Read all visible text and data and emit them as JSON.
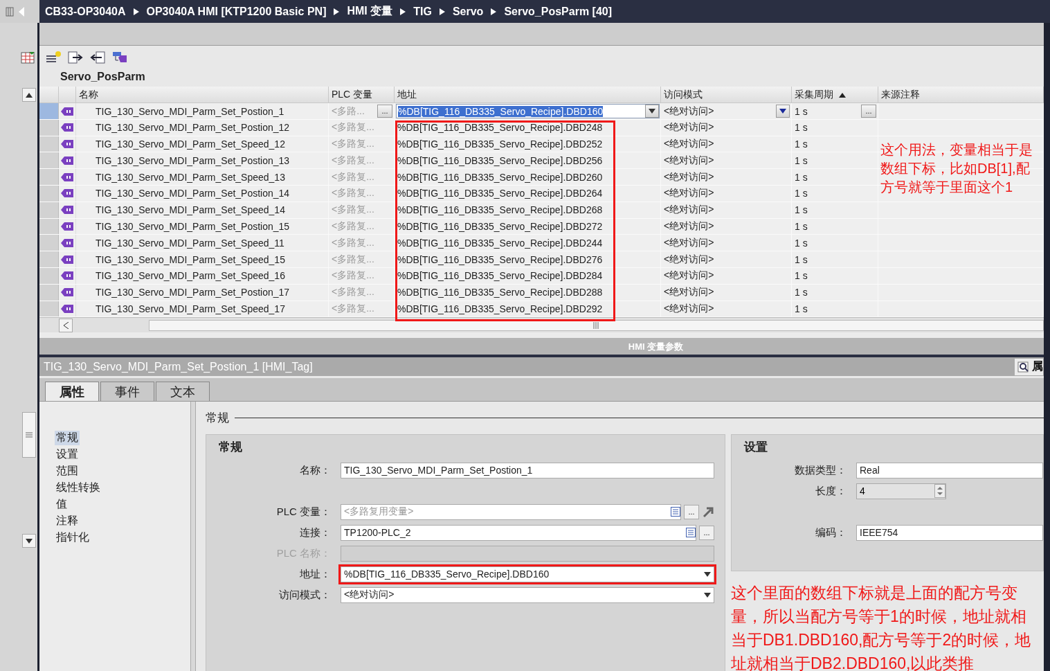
{
  "breadcrumb": [
    "CB33-OP3040A",
    "OP3040A HMI [KTP1200 Basic PN]",
    "HMI 变量",
    "TIG",
    "Servo",
    "Servo_PosParm [40]"
  ],
  "editor_title": "Servo_PosParm",
  "table": {
    "columns": [
      {
        "label": "名称",
        "sorted": false
      },
      {
        "label": "PLC 变量",
        "sorted": false
      },
      {
        "label": "地址",
        "sorted": false
      },
      {
        "label": "访问模式",
        "sorted": false
      },
      {
        "label": "采集周期",
        "sorted": true
      },
      {
        "label": "来源注释",
        "sorted": false
      }
    ],
    "browse_label": "...",
    "rows": [
      {
        "name": "TIG_130_Servo_MDI_Parm_Set_Postion_1",
        "plc_tag": "<多路...",
        "address": "%DB[TIG_116_DB335_Servo_Recipe].DBD160",
        "access": "<绝对访问>",
        "cycle": "1 s",
        "selected": true
      },
      {
        "name": "TIG_130_Servo_MDI_Parm_Set_Postion_12",
        "plc_tag": "<多路复...",
        "address": "%DB[TIG_116_DB335_Servo_Recipe].DBD248",
        "access": "<绝对访问>",
        "cycle": "1 s",
        "selected": false
      },
      {
        "name": "TIG_130_Servo_MDI_Parm_Set_Speed_12",
        "plc_tag": "<多路复...",
        "address": "%DB[TIG_116_DB335_Servo_Recipe].DBD252",
        "access": "<绝对访问>",
        "cycle": "1 s",
        "selected": false
      },
      {
        "name": "TIG_130_Servo_MDI_Parm_Set_Postion_13",
        "plc_tag": "<多路复...",
        "address": "%DB[TIG_116_DB335_Servo_Recipe].DBD256",
        "access": "<绝对访问>",
        "cycle": "1 s",
        "selected": false
      },
      {
        "name": "TIG_130_Servo_MDI_Parm_Set_Speed_13",
        "plc_tag": "<多路复...",
        "address": "%DB[TIG_116_DB335_Servo_Recipe].DBD260",
        "access": "<绝对访问>",
        "cycle": "1 s",
        "selected": false
      },
      {
        "name": "TIG_130_Servo_MDI_Parm_Set_Postion_14",
        "plc_tag": "<多路复...",
        "address": "%DB[TIG_116_DB335_Servo_Recipe].DBD264",
        "access": "<绝对访问>",
        "cycle": "1 s",
        "selected": false
      },
      {
        "name": "TIG_130_Servo_MDI_Parm_Set_Speed_14",
        "plc_tag": "<多路复...",
        "address": "%DB[TIG_116_DB335_Servo_Recipe].DBD268",
        "access": "<绝对访问>",
        "cycle": "1 s",
        "selected": false
      },
      {
        "name": "TIG_130_Servo_MDI_Parm_Set_Postion_15",
        "plc_tag": "<多路复...",
        "address": "%DB[TIG_116_DB335_Servo_Recipe].DBD272",
        "access": "<绝对访问>",
        "cycle": "1 s",
        "selected": false
      },
      {
        "name": "TIG_130_Servo_MDI_Parm_Set_Speed_11",
        "plc_tag": "<多路复...",
        "address": "%DB[TIG_116_DB335_Servo_Recipe].DBD244",
        "access": "<绝对访问>",
        "cycle": "1 s",
        "selected": false
      },
      {
        "name": "TIG_130_Servo_MDI_Parm_Set_Speed_15",
        "plc_tag": "<多路复...",
        "address": "%DB[TIG_116_DB335_Servo_Recipe].DBD276",
        "access": "<绝对访问>",
        "cycle": "1 s",
        "selected": false
      },
      {
        "name": "TIG_130_Servo_MDI_Parm_Set_Speed_16",
        "plc_tag": "<多路复...",
        "address": "%DB[TIG_116_DB335_Servo_Recipe].DBD284",
        "access": "<绝对访问>",
        "cycle": "1 s",
        "selected": false
      },
      {
        "name": "TIG_130_Servo_MDI_Parm_Set_Postion_17",
        "plc_tag": "<多路复...",
        "address": "%DB[TIG_116_DB335_Servo_Recipe].DBD288",
        "access": "<绝对访问>",
        "cycle": "1 s",
        "selected": false
      },
      {
        "name": "TIG_130_Servo_MDI_Parm_Set_Speed_17",
        "plc_tag": "<多路复...",
        "address": "%DB[TIG_116_DB335_Servo_Recipe].DBD292",
        "access": "<绝对访问>",
        "cycle": "1 s",
        "selected": false
      }
    ]
  },
  "table_note": "这个用法，变量相当于是数组下标，比如DB[1],配方号就等于里面这个1",
  "splitter_label": "HMI 变量参数",
  "inspector": {
    "title": "TIG_130_Servo_MDI_Parm_Set_Postion_1 [HMI_Tag]",
    "side_tab": "属",
    "tabs": [
      {
        "label": "属性",
        "selected": true
      },
      {
        "label": "事件",
        "selected": false
      },
      {
        "label": "文本",
        "selected": false
      }
    ],
    "nav": [
      {
        "label": "常规",
        "selected": true
      },
      {
        "label": "设置",
        "selected": false
      },
      {
        "label": "范围",
        "selected": false
      },
      {
        "label": "线性转换",
        "selected": false
      },
      {
        "label": "值",
        "selected": false
      },
      {
        "label": "注释",
        "selected": false
      },
      {
        "label": "指针化",
        "selected": false
      }
    ],
    "section": "常规",
    "general": {
      "title": "常规",
      "fields": [
        {
          "label": "名称：",
          "kind": "text",
          "value": "TIG_130_Servo_MDI_Parm_Set_Postion_1",
          "disabled": false,
          "highlighted": false
        },
        {
          "label": "PLC 变量：",
          "kind": "picker",
          "placeholder": "<多路复用变量>",
          "browse_label": "...",
          "disabled": false,
          "highlighted": false
        },
        {
          "label": "连接：",
          "kind": "picker",
          "value": "TP1200-PLC_2",
          "browse_label": "...",
          "disabled": false,
          "highlighted": false
        },
        {
          "label": "PLC 名称：",
          "kind": "text",
          "disabled": true,
          "highlighted": false
        },
        {
          "label": "地址：",
          "kind": "dropdown",
          "value": "%DB[TIG_116_DB335_Servo_Recipe].DBD160",
          "disabled": false,
          "highlighted": true
        },
        {
          "label": "访问模式：",
          "kind": "dropdown",
          "value": "<绝对访问>",
          "disabled": false,
          "highlighted": false
        }
      ]
    },
    "settings": {
      "title": "设置",
      "fields": [
        {
          "label": "数据类型：",
          "kind": "text",
          "value": "Real"
        },
        {
          "label": "长度：",
          "kind": "spinner",
          "value": "4"
        },
        {
          "label": "编码：",
          "kind": "text",
          "value": "IEEE754"
        }
      ]
    },
    "note": "这个里面的数组下标就是上面的配方号变量，所以当配方号等于1的时候，地址就相当于DB1.DBD160,配方号等于2的时候，地址就相当于DB2.DBD160,以此类推"
  }
}
